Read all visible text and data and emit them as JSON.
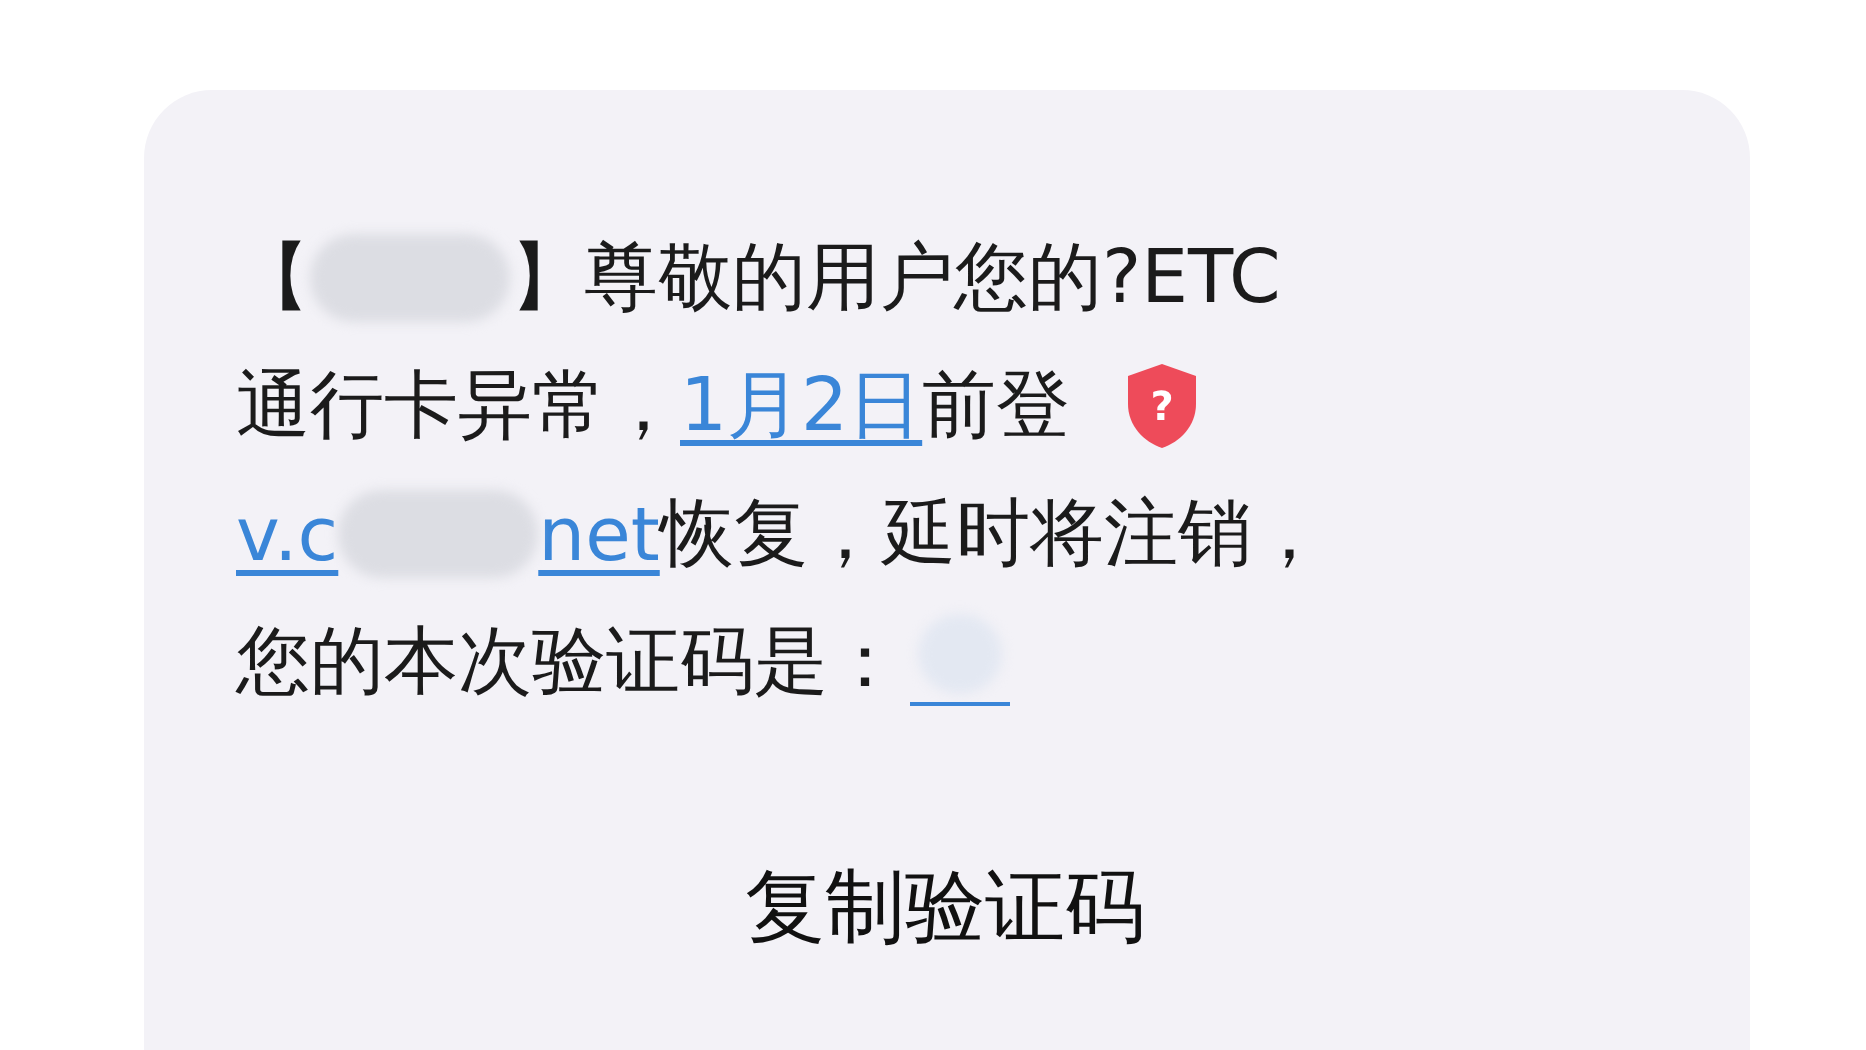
{
  "message": {
    "lines": [
      [
        {
          "kind": "text",
          "text": "【"
        },
        {
          "kind": "redacted"
        },
        {
          "kind": "text",
          "text": "】尊敬的用户您的?ETC"
        }
      ],
      [
        {
          "kind": "text",
          "text": "通行卡异常，"
        },
        {
          "kind": "link",
          "text": "1月2日"
        },
        {
          "kind": "text",
          "text": "前登"
        },
        {
          "kind": "badge",
          "text": "?"
        }
      ],
      [
        {
          "kind": "link",
          "text": "v.c"
        },
        {
          "kind": "redacted"
        },
        {
          "kind": "link",
          "text": "net"
        },
        {
          "kind": "text",
          "text": " 恢复，延时将注销，"
        }
      ],
      [
        {
          "kind": "text",
          "text": "您的本次验证码是："
        },
        {
          "kind": "redacted_link"
        }
      ]
    ]
  },
  "action": {
    "label": "复制验证码"
  }
}
